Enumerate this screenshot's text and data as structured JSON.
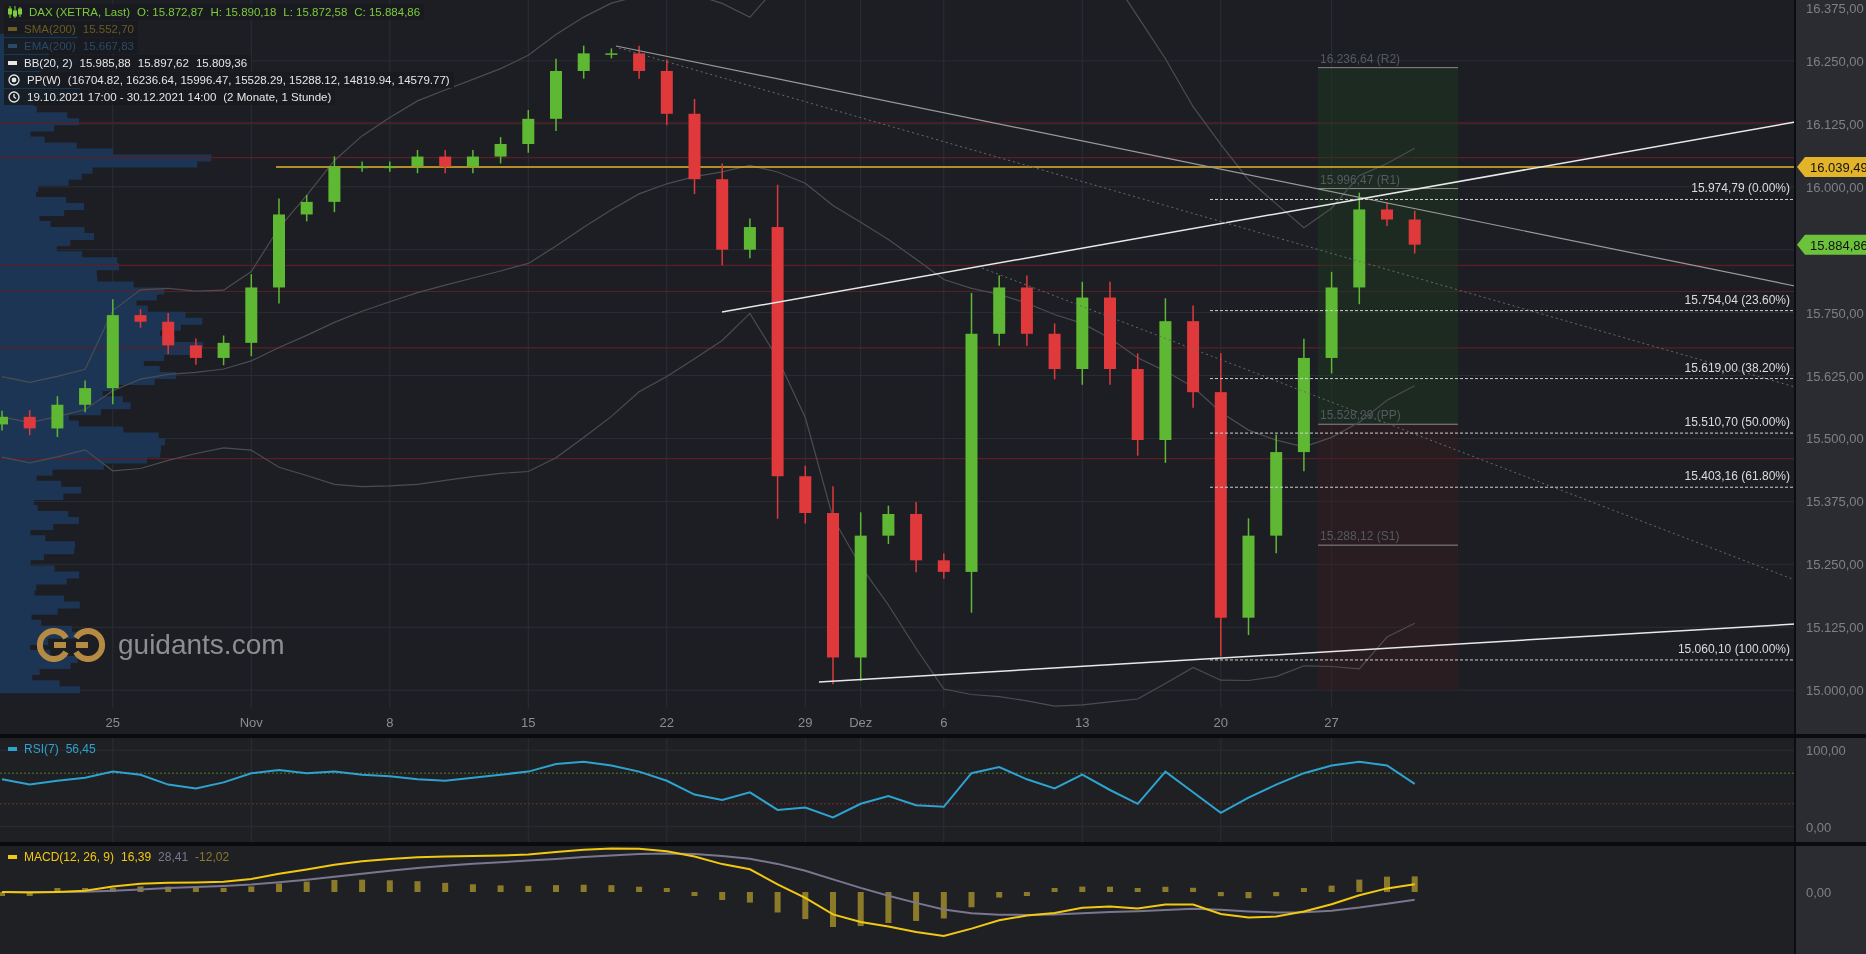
{
  "legend": [
    {
      "kind": "instrument",
      "label": "DAX (XETRA, Last)",
      "values": [
        "O: 15.872,87",
        "H: 15.890,18",
        "L: 15.872,58",
        "C: 15.884,86"
      ],
      "color": "#7ccb3b"
    },
    {
      "kind": "line",
      "label": "SMA(200)",
      "values": [
        "15.552,70"
      ],
      "color": "#6b5c22"
    },
    {
      "kind": "line",
      "label": "EMA(200)",
      "values": [
        "15.667,83"
      ],
      "color": "#2a4a69"
    },
    {
      "kind": "line",
      "label": "BB(20, 2)",
      "values": [
        "15.985,88",
        "15.897,62",
        "15.809,36"
      ],
      "color": "#e6e6e6"
    },
    {
      "kind": "pivot",
      "label": "PP(W)",
      "values": [
        "(16704.82, 16236.64, 15996.47, 15528.29, 15288.12, 14819.94, 14579.77)"
      ],
      "color": "#e6e6e6"
    },
    {
      "kind": "time",
      "label": "19.10.2021 17:00 - 30.12.2021 14:00",
      "values": [
        "(2 Monate, 1 Stunde)"
      ],
      "color": "#e6e6e6"
    }
  ],
  "chart": {
    "price_axis": [
      "16.375,00",
      "16.250,00",
      "16.125,00",
      "16.000,00",
      "15.750,00",
      "15.625,00",
      "15.500,00",
      "15.375,00",
      "15.250,00",
      "15.125,00",
      "15.000,00"
    ],
    "date_axis": [
      "25",
      "Nov",
      "8",
      "15",
      "22",
      "29",
      "Dez",
      "6",
      "13",
      "20",
      "27"
    ],
    "pivot_levels": [
      "16.236,64 (R2)",
      "15.996,47 (R1)",
      "15.528,29 (PP)",
      "15.288,12 (S1)"
    ],
    "fibonacci_levels": [
      "15.974,79 (0.00%)",
      "15.754,04 (23.60%)",
      "15.619,00 (38.20%)",
      "15.510,70 (50.00%)",
      "15.403,16 (61.80%)",
      "15.060,10 (100.00%)"
    ],
    "price_tags": [
      {
        "label": "16.039,49",
        "color": "#e3b42a"
      },
      {
        "label": "15.884,86",
        "color": "#6cc23a"
      }
    ]
  },
  "logo": {
    "text": "guidants.com"
  },
  "rsi": {
    "label": "RSI(7)",
    "value": "56,45",
    "color": "#2ea3cf",
    "axis": [
      "100,00",
      "0,00"
    ]
  },
  "macd": {
    "label": "MACD(12, 26, 9)",
    "values": [
      {
        "text": "16,39",
        "color": "#f2c811"
      },
      {
        "text": "28,41",
        "color": "#7a7690"
      },
      {
        "text": "-12,02",
        "color": "#8a7a2a"
      }
    ],
    "axis": [
      "0,00"
    ]
  }
}
